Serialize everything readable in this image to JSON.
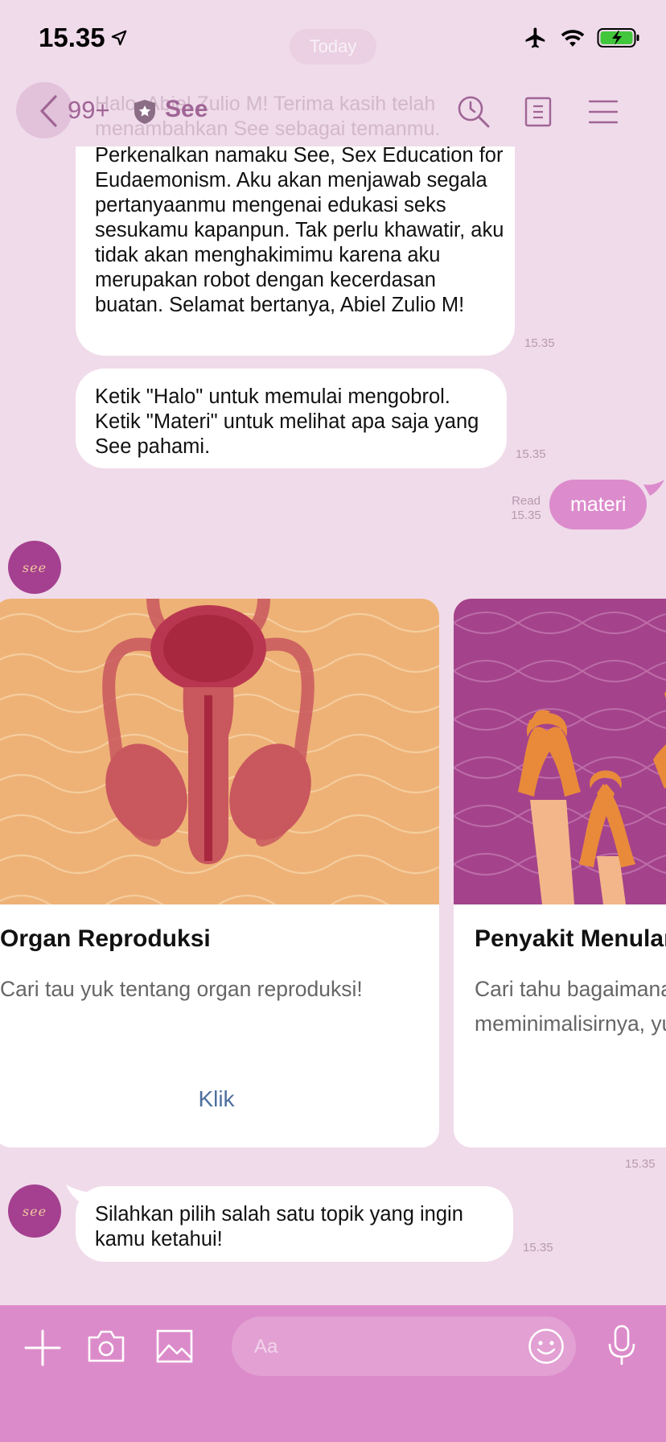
{
  "status_bar": {
    "time": "15.35"
  },
  "header": {
    "unread_count": "99+",
    "chat_name": "See",
    "date_pill": "Today"
  },
  "messages": {
    "intro_faded": "Halo, Abiel Zulio M! Terima kasih telah\nmenambahkan See sebagai temanmu.",
    "intro_body": "Perkenalkan namaku See, Sex Education for Eudaemonism. Aku akan menjawab segala pertanyaanmu mengenai edukasi seks sesukamu kapanpun. Tak perlu khawatir, aku tidak akan menghakimimu karena aku merupakan robot dengan kecerdasan buatan.\nSelamat bertanya, Abiel Zulio M!",
    "intro_time": "15.35",
    "howto_body": "Ketik \"Halo\" untuk memulai mengobrol.\nKetik \"Materi\" untuk melihat apa saja yang See pahami.",
    "howto_time": "15.35",
    "sent_text": "materi",
    "sent_read": "Read",
    "sent_time": "15.35",
    "carousel_time": "15.35",
    "prompt_body": "Silahkan pilih salah satu topik yang ingin kamu ketahui!",
    "prompt_time": "15.35"
  },
  "avatar_text": "see",
  "cards": [
    {
      "title": "Organ Reproduksi",
      "description": "Cari tau yuk tentang organ reproduksi!",
      "action": "Klik"
    },
    {
      "title": "Penyakit Menular Seksual",
      "description": "Cari tahu bagaimana\nmeminimalisirnya, yuk!"
    }
  ],
  "composer": {
    "placeholder": "Aa"
  },
  "colors": {
    "background": "#f0dbea",
    "accent_text": "#a06596",
    "sent_bubble": "#dc8ccc",
    "bottom_bar": "#dc8bca",
    "card1_bg": "#eeb277",
    "card2_bg": "#a4438b",
    "link": "#4e6f9e"
  }
}
